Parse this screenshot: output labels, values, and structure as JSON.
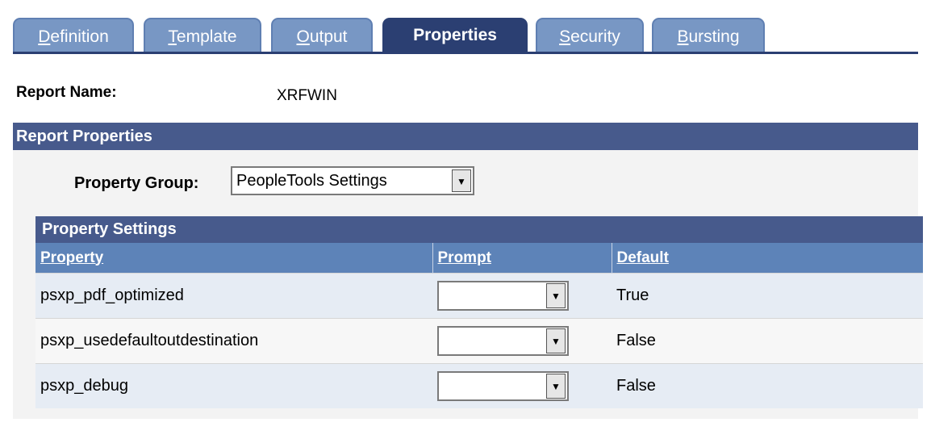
{
  "tabs": [
    {
      "first": "D",
      "rest": "efinition",
      "active": false
    },
    {
      "first": "T",
      "rest": "emplate",
      "active": false
    },
    {
      "first": "O",
      "rest": "utput",
      "active": false
    },
    {
      "first": "",
      "rest": "Properties",
      "active": true
    },
    {
      "first": "S",
      "rest": "ecurity",
      "active": false
    },
    {
      "first": "B",
      "rest": "ursting",
      "active": false
    }
  ],
  "report": {
    "label": "Report Name:",
    "value": "XRFWIN"
  },
  "report_properties": {
    "title": "Report Properties",
    "property_group_label": "Property Group:",
    "property_group_value": "PeopleTools Settings"
  },
  "grid": {
    "title": "Property Settings",
    "columns": [
      "Property",
      "Prompt",
      "Default"
    ],
    "rows": [
      {
        "property": "psxp_pdf_optimized",
        "prompt": "",
        "default": "True"
      },
      {
        "property": "psxp_usedefaultoutdestination",
        "prompt": "",
        "default": "False"
      },
      {
        "property": "psxp_debug",
        "prompt": "",
        "default": "False"
      }
    ]
  },
  "colors": {
    "tab_active": "#2b3f72",
    "tab_inactive": "#7897c4",
    "header": "#475a8c",
    "column_header": "#5d83b8",
    "row_alt": "#e6ecf4"
  }
}
